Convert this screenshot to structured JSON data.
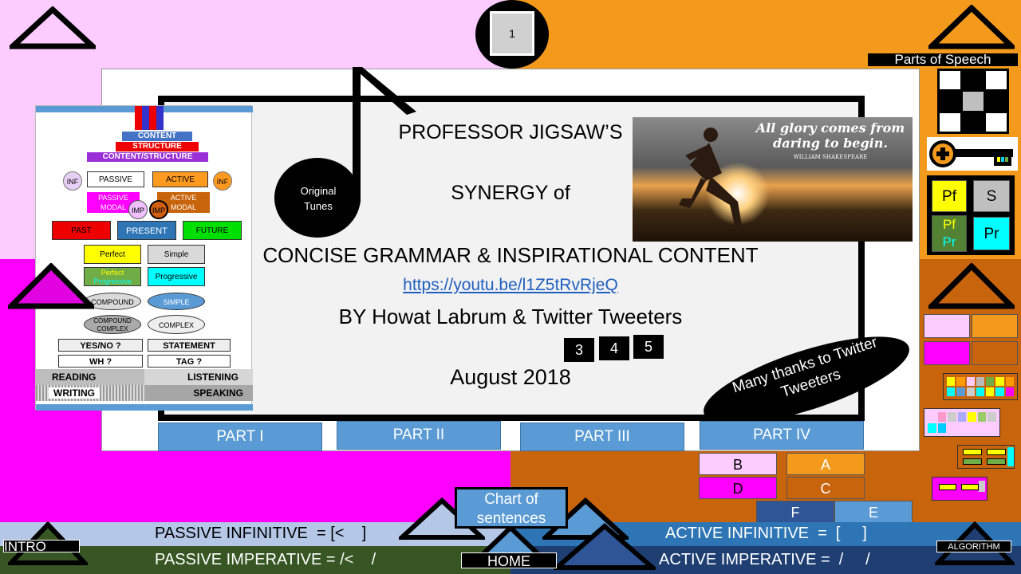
{
  "slide": {
    "page_number": "1",
    "parts_of_speech_label": "Parts of Speech",
    "title_line1": "PROFESSOR JIGSAW’S",
    "title_line2": "SYNERGY of",
    "title_line3": "CONCISE GRAMMAR & INSPIRATIONAL CONTENT",
    "link": "https://youtu.be/l1Z5tRvRjeQ",
    "byline": "BY Howat Labrum & Twitter Tweeters",
    "date": "August 2018",
    "badges": [
      "3",
      "4",
      "5"
    ],
    "original_tunes": "Original Tunes",
    "thanks_banner": "Many thanks to Twitter Tweeters",
    "quote": {
      "text": "All glory comes from daring to begin.",
      "author": "WILLIAM SHAKESPEARE"
    }
  },
  "parts": [
    "PART I",
    "PART II",
    "PART III",
    "PART IV"
  ],
  "letter_buttons": [
    "B",
    "A",
    "D",
    "C",
    "F",
    "E"
  ],
  "tense_panel": {
    "pf": "Pf",
    "s": "S",
    "pfpr_1": "Pf",
    "pfpr_2": "Pr",
    "pr": "Pr"
  },
  "chart": {
    "content": "CONTENT",
    "structure": "STRUCTURE",
    "content_structure": "CONTENT/STRUCTURE",
    "inf": "INF",
    "passive": "PASSIVE",
    "active": "ACTIVE",
    "passive_modal_1": "PASSIVE",
    "passive_modal_2": "MODAL",
    "active_modal_1": "ACTIVE",
    "active_modal_2": "MODAL",
    "imp": "IMP",
    "past": "PAST",
    "present": "PRESENT",
    "future": "FUTURE",
    "perfect": "Perfect",
    "simple": "Simple",
    "perfect_progressive_1": "Perfect",
    "perfect_progressive_2": "Progressive",
    "progressive": "Progressive",
    "compound": "COMPOUND",
    "simple_sentence": "SIMPLE",
    "compound_complex_1": "COMPOUND",
    "compound_complex_2": "COMPLEX",
    "complex": "COMPLEX",
    "yes_no": "YES/NO ?",
    "statement": "STATEMENT",
    "wh": "WH ?",
    "tag": "TAG ?",
    "reading": "READING",
    "listening": "LISTENING",
    "writing": "WRITING",
    "speaking": "SPEAKING"
  },
  "bottom": {
    "passive_infinitive": "PASSIVE INFINITIVE  = [<    ]",
    "passive_imperative": "PASSIVE IMPERATIVE = /<    /",
    "active_infinitive": "ACTIVE INFINITIVE  =  [     ]",
    "active_imperative": "ACTIVE IMPERATIVE =  /     /",
    "chart_of_sentences": "Chart of sentences",
    "intro": "INTRO",
    "home": "HOME",
    "algorithm": "ALGORITHM"
  },
  "colors": {
    "pink": "#fccbff",
    "magenta": "#ff00ff",
    "orange": "#f39a1c",
    "brown": "#c8640c",
    "blue": "#5b9bd5",
    "navy": "#1f3f73",
    "dark_green": "#375623"
  }
}
